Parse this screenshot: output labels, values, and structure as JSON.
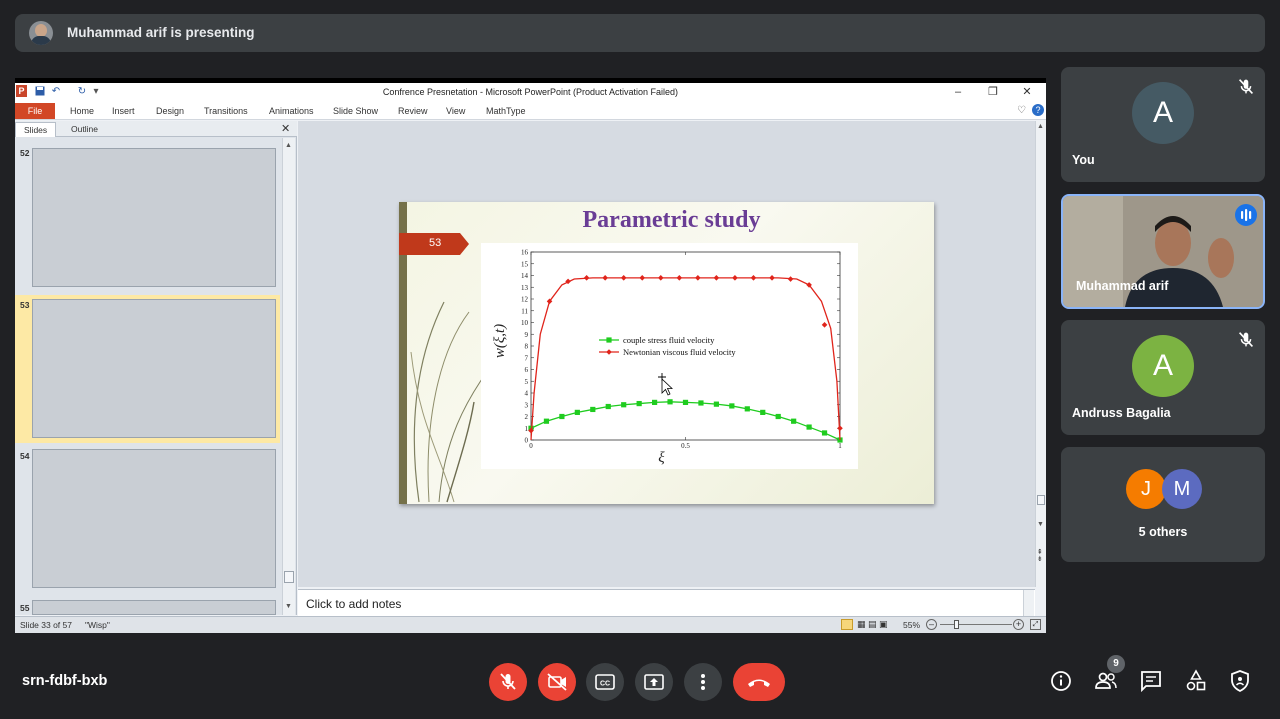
{
  "presenting": {
    "text": "Muhammad arif is presenting"
  },
  "powerpoint": {
    "window_title": "Confrence Presnetation - Microsoft PowerPoint (Product Activation Failed)",
    "logo_letter": "P",
    "file_tab": "File",
    "tabs": [
      "Home",
      "Insert",
      "Design",
      "Transitions",
      "Animations",
      "Slide Show",
      "Review",
      "View",
      "MathType"
    ],
    "pane_tabs": {
      "slides": "Slides",
      "outline": "Outline"
    },
    "thumb_numbers": [
      "52",
      "53",
      "54",
      "55"
    ],
    "notes_placeholder": "Click to add notes",
    "status": {
      "slide_of": "Slide 33 of 57",
      "theme": "\"Wisp\"",
      "zoom": "55%"
    },
    "slide": {
      "title": "Parametric study",
      "number": "53"
    }
  },
  "chart_data": {
    "type": "line",
    "title": "",
    "xlabel": "ξ",
    "ylabel": "w(ξ,t)",
    "xlim": [
      0,
      1
    ],
    "ylim": [
      0,
      16
    ],
    "xticks": [
      "0",
      "0.5",
      "1"
    ],
    "yticks": [
      "0",
      "1",
      "2",
      "3",
      "4",
      "5",
      "6",
      "7",
      "8",
      "9",
      "10",
      "11",
      "12",
      "13",
      "14",
      "15",
      "16"
    ],
    "legend_position": "center",
    "series": [
      {
        "name": "couple stress fluid velocity",
        "color": "#1fcc1f",
        "marker": "square",
        "x": [
          0,
          0.05,
          0.1,
          0.15,
          0.2,
          0.25,
          0.3,
          0.35,
          0.4,
          0.45,
          0.5,
          0.55,
          0.6,
          0.65,
          0.7,
          0.75,
          0.8,
          0.85,
          0.9,
          0.95,
          1.0
        ],
        "y": [
          1.0,
          1.6,
          2.0,
          2.35,
          2.6,
          2.85,
          3.0,
          3.1,
          3.2,
          3.25,
          3.2,
          3.15,
          3.05,
          2.9,
          2.65,
          2.35,
          2.0,
          1.6,
          1.1,
          0.6,
          0.0
        ]
      },
      {
        "name": "Newtonian viscous fluid velocity",
        "color": "#e0241b",
        "marker": "diamond",
        "x": [
          0,
          0.01,
          0.03,
          0.06,
          0.1,
          0.14,
          0.2,
          0.25,
          0.3,
          0.35,
          0.4,
          0.45,
          0.5,
          0.55,
          0.6,
          0.65,
          0.7,
          0.75,
          0.8,
          0.86,
          0.9,
          0.94,
          0.97,
          0.99,
          1.0
        ],
        "y": [
          0.0,
          4.0,
          9.0,
          11.8,
          13.2,
          13.7,
          13.8,
          13.8,
          13.8,
          13.8,
          13.8,
          13.8,
          13.8,
          13.8,
          13.8,
          13.8,
          13.8,
          13.8,
          13.8,
          13.7,
          13.2,
          11.8,
          9.5,
          5.0,
          0.0
        ],
        "marker_x": [
          0,
          0.06,
          0.12,
          0.18,
          0.24,
          0.3,
          0.36,
          0.42,
          0.48,
          0.54,
          0.6,
          0.66,
          0.72,
          0.78,
          0.84,
          0.9,
          0.95,
          1.0
        ],
        "marker_y": [
          0.8,
          11.8,
          13.5,
          13.8,
          13.8,
          13.8,
          13.8,
          13.8,
          13.8,
          13.8,
          13.8,
          13.8,
          13.8,
          13.8,
          13.7,
          13.2,
          9.8,
          1.0
        ]
      }
    ]
  },
  "participants": {
    "you": {
      "initial": "A",
      "name": "You",
      "color": "#455a64"
    },
    "presenter": {
      "name": "Muhammad arif"
    },
    "andruss": {
      "initial": "A",
      "name": "Andruss Bagalia",
      "color": "#7cb342"
    },
    "others": {
      "initials": [
        "J",
        "M"
      ],
      "colors": [
        "#f57c00",
        "#5c6bc0"
      ],
      "label": "5 others"
    }
  },
  "meeting": {
    "code": "srn-fdbf-bxb",
    "people_count": "9"
  },
  "colors": {
    "background": "#202124",
    "tile": "#3c4043",
    "danger": "#ea4335",
    "accent": "#8ab4f8"
  }
}
